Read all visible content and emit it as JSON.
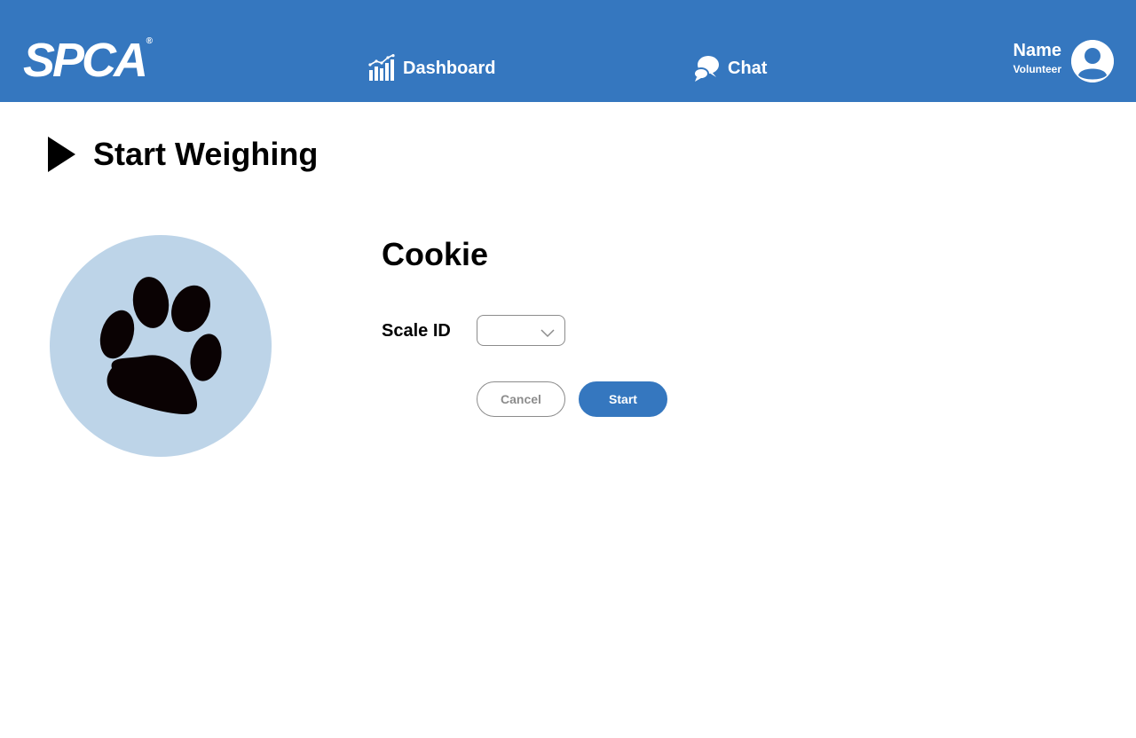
{
  "header": {
    "logo_text": "SPCA",
    "logo_mark": "®",
    "nav": [
      {
        "label": "Dashboard",
        "icon": "bar-chart-icon"
      },
      {
        "label": "Chat",
        "icon": "chat-bubbles-icon"
      }
    ],
    "user": {
      "name": "Name",
      "role": "Volunteer",
      "icon": "user-avatar-icon"
    }
  },
  "page": {
    "title": "Start Weighing",
    "title_icon": "play-icon"
  },
  "pet": {
    "name": "Cookie",
    "photo_icon": "paw-print-icon"
  },
  "form": {
    "scale_label": "Scale ID",
    "scale_value": "",
    "cancel_label": "Cancel",
    "start_label": "Start"
  },
  "colors": {
    "brand": "#3577bf",
    "photo_bg": "#bdd4e8",
    "muted": "#8c8c8c"
  }
}
